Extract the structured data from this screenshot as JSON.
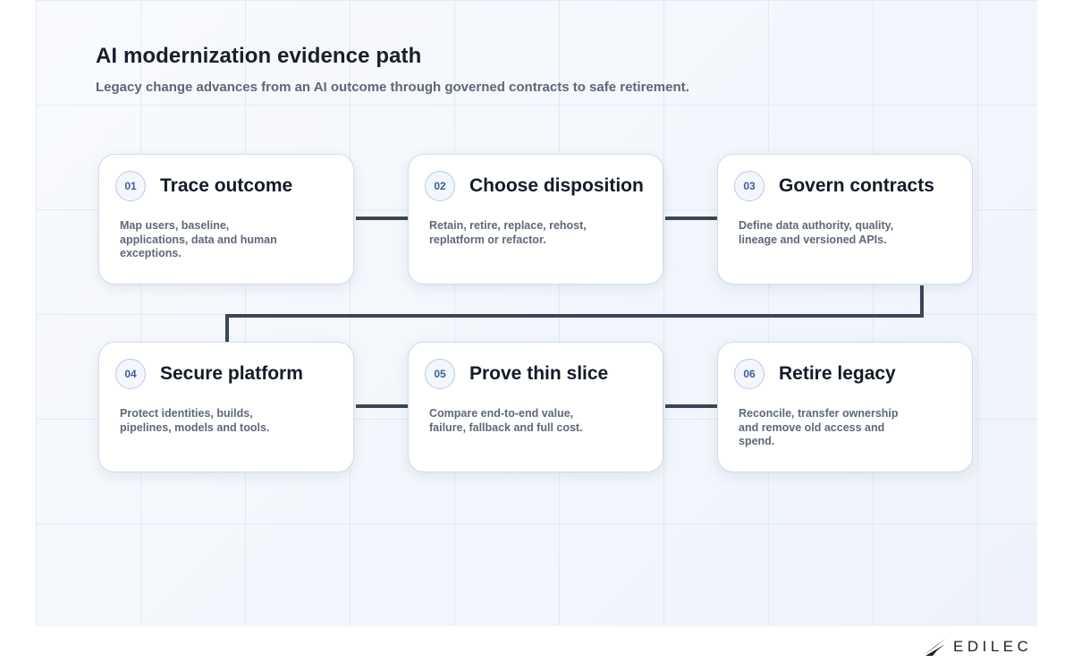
{
  "header": {
    "title": "AI modernization evidence path",
    "subtitle": "Legacy change advances from an AI outcome through governed contracts to safe retirement."
  },
  "steps": [
    {
      "number": "01",
      "title": "Trace outcome",
      "description": "Map users, baseline, applications, data and human exceptions."
    },
    {
      "number": "02",
      "title": "Choose disposition",
      "description": "Retain, retire, replace, rehost, replatform or refactor."
    },
    {
      "number": "03",
      "title": "Govern contracts",
      "description": "Define data authority, quality, lineage and versioned APIs."
    },
    {
      "number": "04",
      "title": "Secure platform",
      "description": "Protect identities, builds, pipelines, models and tools."
    },
    {
      "number": "05",
      "title": "Prove thin slice",
      "description": "Compare end-to-end value, failure, fallback and full cost."
    },
    {
      "number": "06",
      "title": "Retire legacy",
      "description": "Reconcile, transfer ownership and remove old access and spend."
    }
  ],
  "brand": {
    "name": "EDILEC",
    "icon": "edilec-logo-icon"
  },
  "colors": {
    "connector": "#3b4659",
    "badge_text": "#3e5f96",
    "badge_border": "#b8c9e6",
    "title_text": "#16202e",
    "body_text": "#5e6878",
    "panel_background": "#f5f8fc"
  }
}
